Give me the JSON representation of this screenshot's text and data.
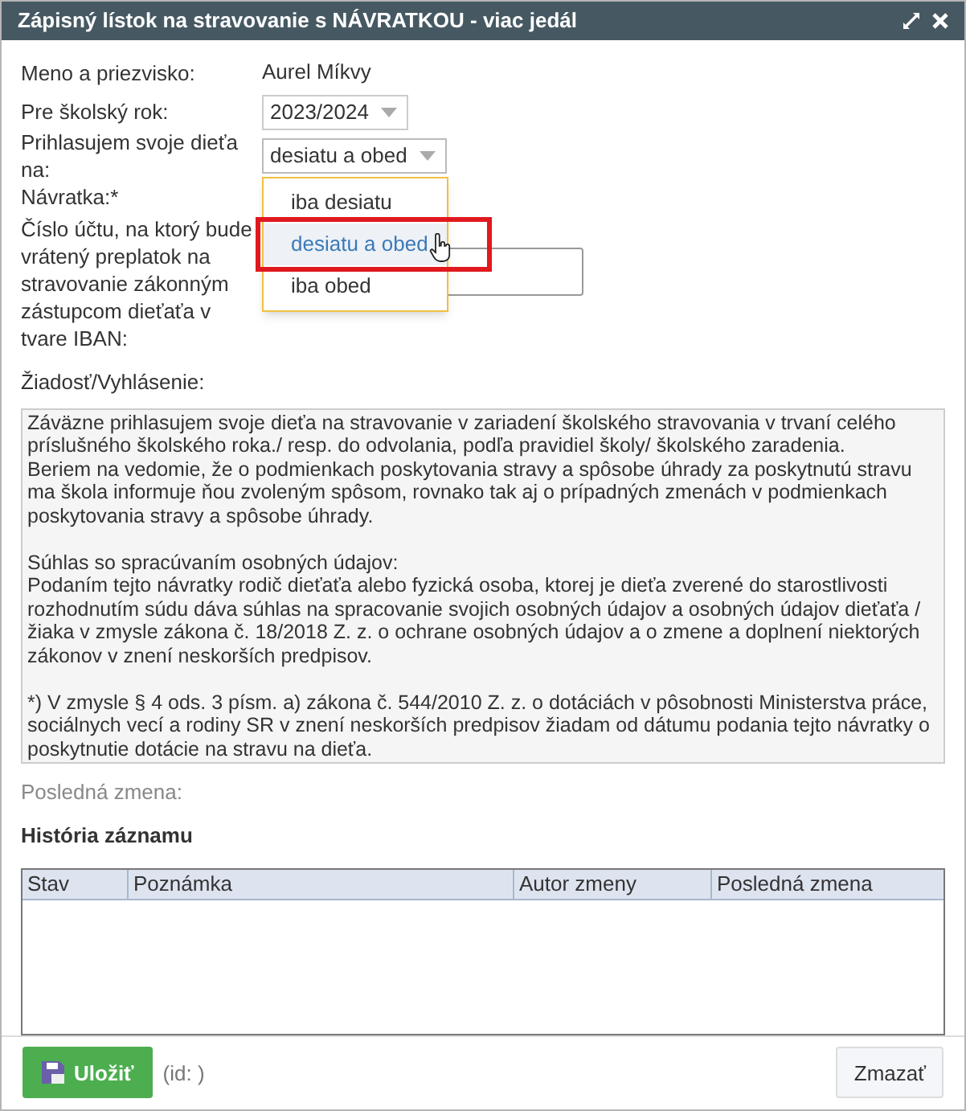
{
  "window": {
    "title": "Zápisný lístok na stravovanie s NÁVRATKOU - viac jedál"
  },
  "fields": [
    {
      "kind": "text",
      "label": "Meno a priezvisko:",
      "value": "Aurel Míkvy"
    },
    {
      "kind": "select",
      "label": "Pre školský rok:",
      "value": "2023/2024"
    },
    {
      "kind": "select",
      "label": "Prihlasujem svoje dieťa na:",
      "value": "desiatu a obed",
      "expanded": true,
      "options": [
        {
          "label": "iba desiatu",
          "selected": false
        },
        {
          "label": "desiatu a obed",
          "selected": true
        },
        {
          "label": "iba obed",
          "selected": false
        }
      ]
    },
    {
      "kind": "none",
      "label": "Návratka:*"
    },
    {
      "kind": "input",
      "label": "Číslo účtu, na ktorý bude vrátený preplatok na stravovanie zákonným zástupcom dieťaťa v tvare IBAN:"
    }
  ],
  "request": {
    "label": "Žiadosť/Vyhlásenie:",
    "value": "Záväzne prihlasujem svoje dieťa na stravovanie v zariadení školského stravovania v trvaní celého príslušného školského roka./ resp. do odvolania, podľa pravidiel školy/ školského zaradenia.\nBeriem na vedomie, že o podmienkach poskytovania stravy a spôsobe úhrady za poskytnutú stravu  ma škola informuje ňou zvoleným spôsom, rovnako tak aj o prípadných zmenách v podmienkach poskytovania stravy a spôsobe úhrady.\n\nSúhlas so spracúvaním osobných údajov:\nPodaním tejto návratky rodič dieťaťa alebo fyzická osoba, ktorej je dieťa zverené do starostlivosti rozhodnutím súdu dáva súhlas na spracovanie svojich osobných údajov a osobných údajov dieťaťa / žiaka v zmysle zákona č. 18/2018 Z. z. o ochrane osobných údajov a o zmene a doplnení niektorých zákonov v znení neskorších predpisov.\n\n*) V zmysle § 4 ods. 3 písm. a) zákona č. 544/2010 Z. z. o dotáciách v pôsobnosti Ministerstva práce, sociálnych vecí a rodiny SR v znení neskorších predpisov žiadam od dátumu podania tejto návratky o poskytnutie dotácie na stravu na dieťa."
  },
  "last_change": {
    "label": "Posledná zmena:"
  },
  "history": {
    "title": "História záznamu",
    "columns": [
      "Stav",
      "Poznámka",
      "Autor zmeny",
      "Posledná zmena"
    ]
  },
  "footer": {
    "save": "Uložiť",
    "id": "(id: )",
    "delete": "Zmazať"
  }
}
